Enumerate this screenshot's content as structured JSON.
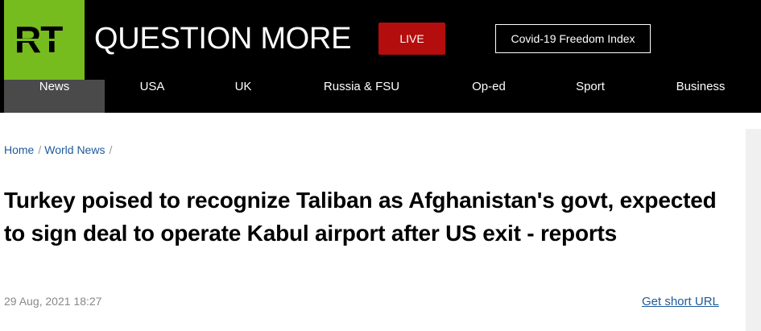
{
  "header": {
    "logo_text": "RT",
    "brand": "QUESTION MORE",
    "live_label": "LIVE",
    "covid_label": "Covid-19 Freedom Index",
    "colors": {
      "logo": "#77bc1f",
      "live": "#b30d0d",
      "bar": "#000000"
    }
  },
  "nav": {
    "items": [
      {
        "label": "News",
        "active": true
      },
      {
        "label": "USA"
      },
      {
        "label": "UK"
      },
      {
        "label": "Russia & FSU"
      },
      {
        "label": "Op-ed"
      },
      {
        "label": "Sport"
      },
      {
        "label": "Business"
      }
    ]
  },
  "breadcrumb": {
    "items": [
      {
        "label": "Home"
      },
      {
        "label": "World News"
      }
    ],
    "separator": "/"
  },
  "article": {
    "title": "Turkey poised to recognize Taliban as Afghanistan's govt, expected to sign deal to operate Kabul airport after US exit - reports",
    "date": "29 Aug, 2021 18:27",
    "short_url_label": "Get short URL"
  }
}
